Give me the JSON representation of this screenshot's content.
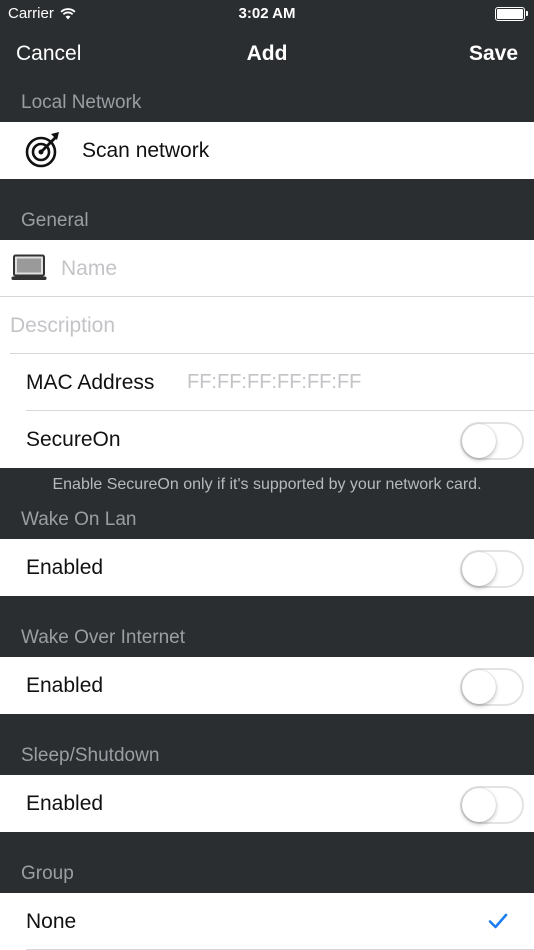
{
  "status_bar": {
    "carrier": "Carrier",
    "time": "3:02 AM"
  },
  "nav": {
    "cancel": "Cancel",
    "title": "Add",
    "save": "Save"
  },
  "sections": {
    "local_network": {
      "header": "Local Network",
      "scan_label": "Scan network"
    },
    "general": {
      "header": "General",
      "name_placeholder": "Name",
      "description_placeholder": "Description",
      "mac_label": "MAC Address",
      "mac_placeholder": "FF:FF:FF:FF:FF:FF",
      "secureon_label": "SecureOn",
      "secureon_on": false,
      "footer": "Enable SecureOn only if it's supported by your network card."
    },
    "wake_on_lan": {
      "header": "Wake On Lan",
      "enabled_label": "Enabled",
      "on": false
    },
    "wake_over_internet": {
      "header": "Wake Over Internet",
      "enabled_label": "Enabled",
      "on": false
    },
    "sleep_shutdown": {
      "header": "Sleep/Shutdown",
      "enabled_label": "Enabled",
      "on": false
    },
    "group": {
      "header": "Group",
      "selected": "None"
    }
  },
  "colors": {
    "background": "#2b2e31",
    "accent": "#1d7ef0",
    "header_text": "#9a9ea2"
  },
  "icons": {
    "scan": "radar-icon",
    "computer": "laptop-icon",
    "check": "checkmark-icon"
  }
}
